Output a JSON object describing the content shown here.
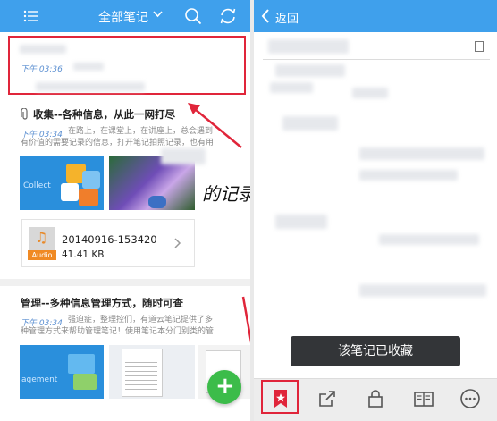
{
  "left": {
    "header": {
      "title": "全部笔记",
      "icons": [
        "menu-icon",
        "chevron-down-icon",
        "search-icon",
        "sync-icon"
      ]
    },
    "notes": [
      {
        "time": "下午 03:36"
      },
      {
        "title": "收集--各种信息，从此一网打尽",
        "time": "下午 03:34",
        "snippet_line1": "在路上，在课堂上，在讲座上，总会遇到",
        "snippet_line2": "有价值的需要记录的信息，打开笔记拍照记录，也有用",
        "thumb_text": "Collect",
        "handwriting_text": "的记录",
        "attachment": {
          "filename": "20140916-153420",
          "size": "41.41 KB",
          "badge": "Audio"
        }
      },
      {
        "title": "管理--多种信息管理方式，随时可查",
        "time": "下午 03:34",
        "snippet_line1": "强迫症，整理控们，有道云笔记提供了多",
        "snippet_line2": "种管理方式来帮助管理笔记！使用笔记本分门别类的管",
        "thumb_text": "agement"
      }
    ],
    "fab_label": "+"
  },
  "right": {
    "header": {
      "back_label": "返回"
    },
    "toast": "该笔记已收藏",
    "toolbar": [
      "star-icon",
      "share-icon",
      "lock-icon",
      "book-icon",
      "more-icon"
    ]
  },
  "colors": {
    "header_blue": "#3fa0ec",
    "highlight_red": "#e0253a",
    "fab_green": "#3cbc4a",
    "time_blue": "#5b8fd1"
  }
}
